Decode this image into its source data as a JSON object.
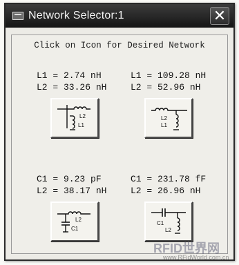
{
  "window": {
    "title": "Network Selector:1",
    "close_glyph": "✕"
  },
  "panel": {
    "instruction": "Click on Icon for Desired Network"
  },
  "options": [
    {
      "line1": "L1 = 2.74 nH",
      "line2": "L2 = 33.26 nH",
      "icon": "shunt-L2-series-L1-network-icon",
      "labels": [
        "L2",
        "L1"
      ]
    },
    {
      "line1": "L1 = 109.28 nH",
      "line2": "L2 = 52.96 nH",
      "icon": "series-L1-shunt-L2-network-icon",
      "labels": [
        "L2",
        "L1"
      ]
    },
    {
      "line1": "C1 = 9.23 pF",
      "line2": "L2 = 38.17 nH",
      "icon": "series-L2-shunt-C1-network-icon",
      "labels": [
        "L2",
        "C1"
      ]
    },
    {
      "line1": "C1 = 231.78 fF",
      "line2": "L2 = 26.96 nH",
      "icon": "series-C1-shunt-L2-network-icon",
      "labels": [
        "C1",
        "L2"
      ]
    }
  ],
  "watermark": {
    "text": "RFID世界网",
    "url": "www.RFidWorld.com.cn"
  }
}
